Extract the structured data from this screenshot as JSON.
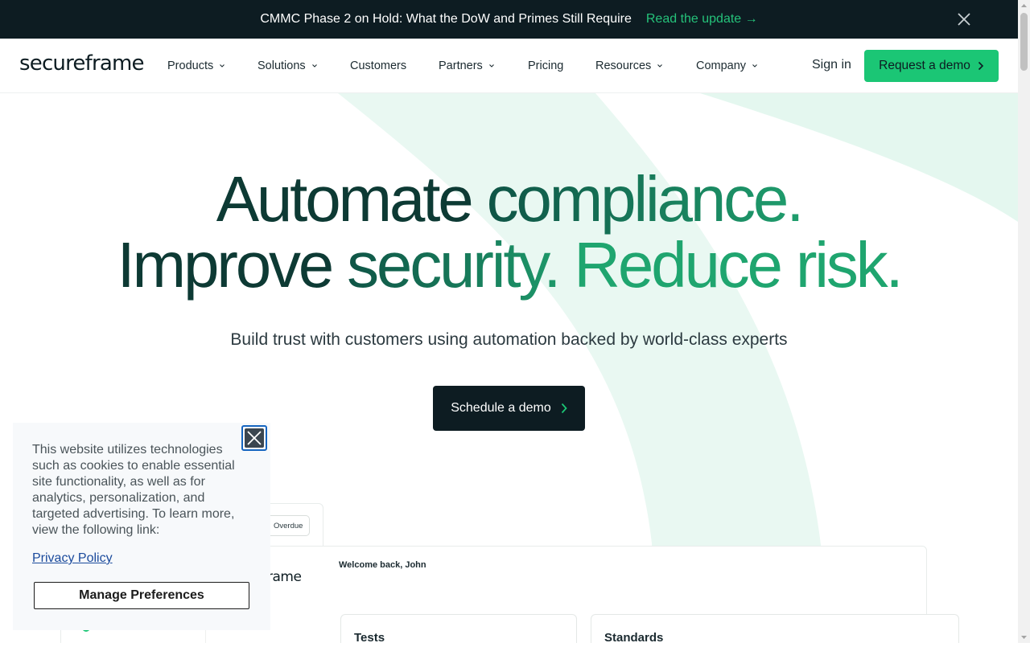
{
  "announcement": {
    "text": "CMMC Phase 2 on Hold: What the DoW and Primes Still Require",
    "link": "Read the update →",
    "close_icon": "close-icon"
  },
  "nav": {
    "logo": "secureframe",
    "items": [
      {
        "label": "Products",
        "has_caret": true
      },
      {
        "label": "Solutions",
        "has_caret": true
      },
      {
        "label": "Customers",
        "has_caret": false
      },
      {
        "label": "Partners",
        "has_caret": true
      },
      {
        "label": "Pricing",
        "has_caret": false
      },
      {
        "label": "Resources",
        "has_caret": true
      },
      {
        "label": "Company",
        "has_caret": true
      }
    ],
    "sign_in": "Sign in",
    "cta": "Request a demo"
  },
  "hero": {
    "headline_1a": "Automate ",
    "headline_1b": "compliance.",
    "headline_2a": "Improve ",
    "headline_2b": "security. ",
    "headline_2c": "Reduce risk.",
    "subheadline": "Build trust with customers using automation backed by world-class experts",
    "cta": "Schedule a demo"
  },
  "preview": {
    "overdue_badge": "Overdue",
    "logo_fragment": "rame",
    "welcome": "Welcome back, John",
    "panels": [
      "Tests",
      "Standards"
    ]
  },
  "cookie": {
    "text": "This website utilizes technologies such as cookies to enable essential site functionality, as well as for analytics, personalization, and targeted advertising. To learn more, view the following link:",
    "privacy_link": "Privacy Policy",
    "manage_button": "Manage Preferences"
  },
  "colors": {
    "brand_green": "#1bc675",
    "dark": "#0d1c22",
    "link_blue": "#1a4a9c"
  }
}
